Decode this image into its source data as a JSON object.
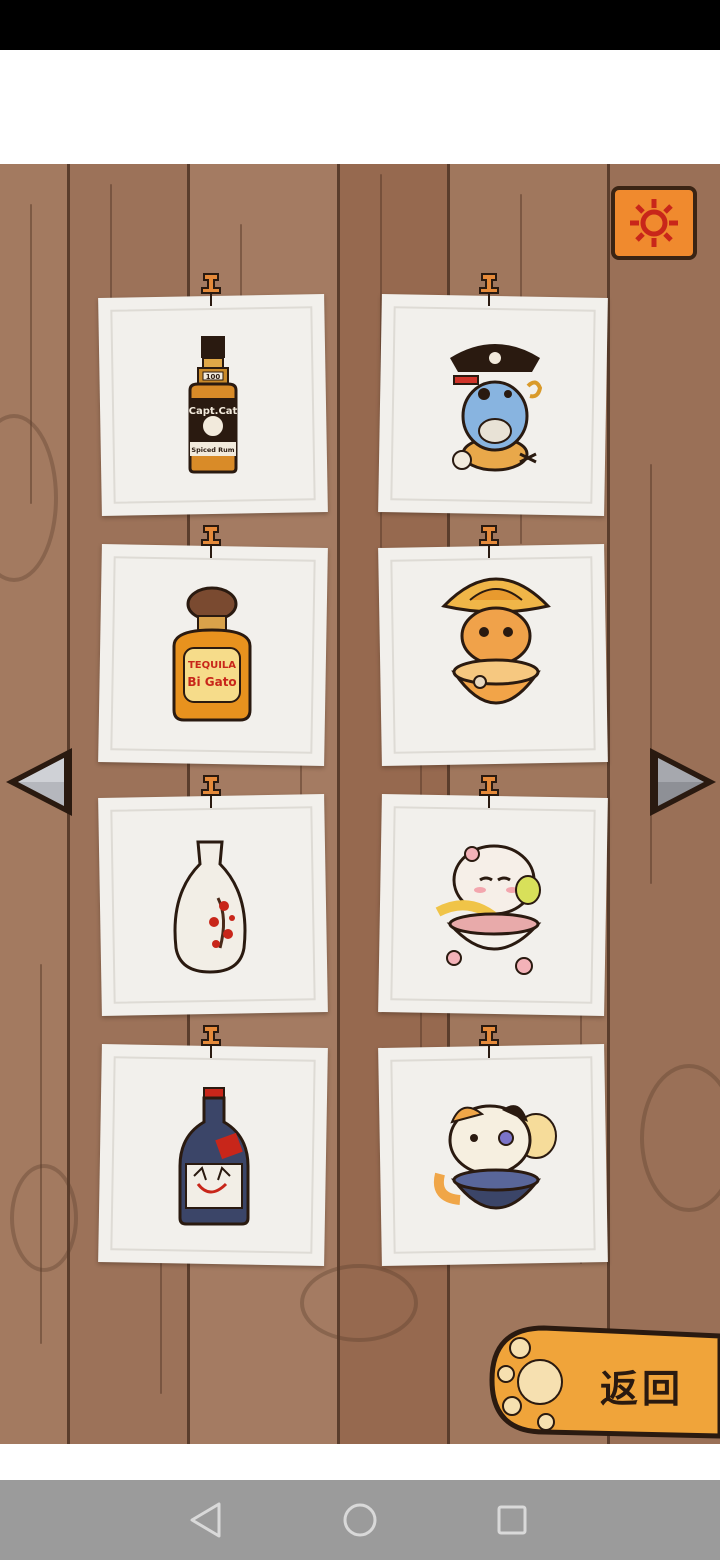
{
  "game": {
    "back_button_label": "返回",
    "items": [
      {
        "icon": "rum-bottle-icon",
        "label_lines": [
          "Capt.Cat",
          "Spiced Rum"
        ],
        "badge": "100"
      },
      {
        "icon": "pirate-cat-icon"
      },
      {
        "icon": "tequila-bottle-icon",
        "label_lines": [
          "TEQUILA",
          "Bi Gato"
        ]
      },
      {
        "icon": "sombrero-cat-icon"
      },
      {
        "icon": "sake-vase-icon"
      },
      {
        "icon": "cherry-blossom-cat-icon"
      },
      {
        "icon": "japanese-bottle-icon"
      },
      {
        "icon": "calico-cat-cup-icon"
      }
    ],
    "colors": {
      "wood": "#9a7057",
      "wood_dark": "#5a3d2c",
      "card": "#f2f0ec",
      "accent_orange": "#f08a2e",
      "nav_bar": "#9b9b9b"
    }
  },
  "navigation": {
    "back_icon": "triangle-back-icon",
    "home_icon": "circle-home-icon",
    "recents_icon": "square-recents-icon"
  }
}
